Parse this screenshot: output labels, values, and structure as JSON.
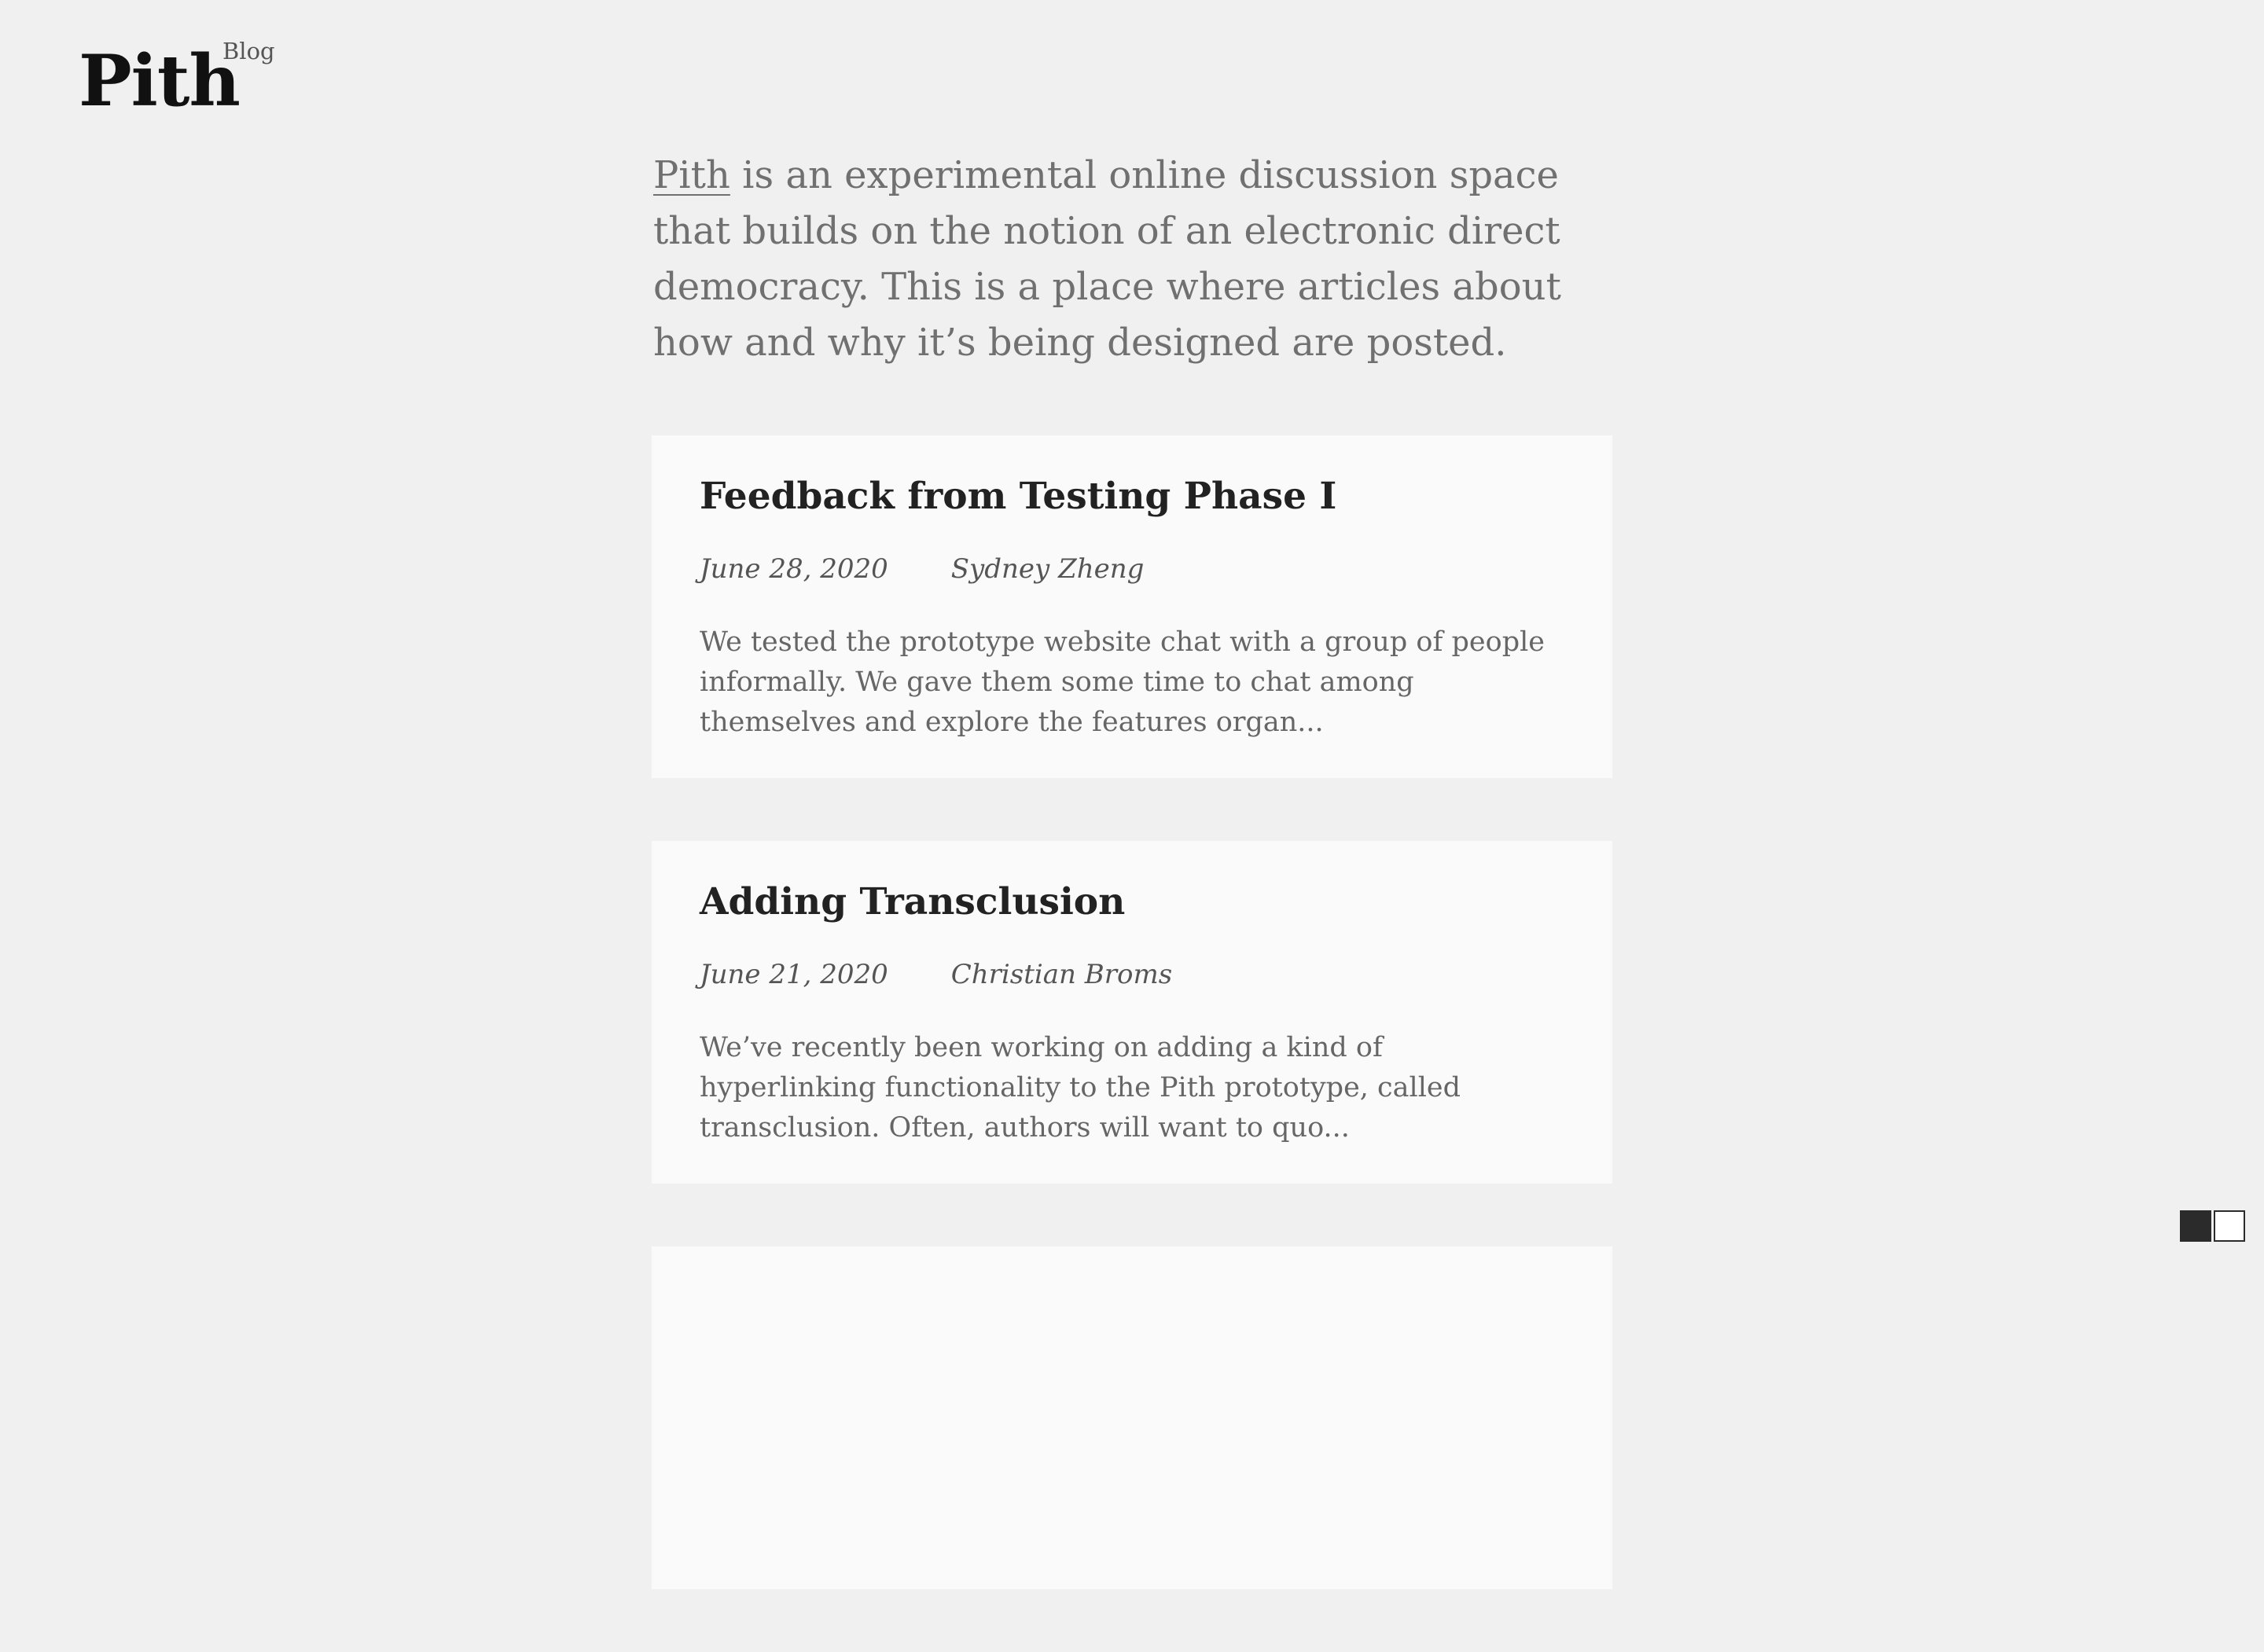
{
  "header": {
    "logo_text": "Pith",
    "logo_subtitle": "Blog"
  },
  "intro": {
    "link_text": "Pith",
    "rest": " is an experimental online discussion space that builds on the notion of an electronic direct democracy. This is a place where articles about how and why it’s being designed are posted."
  },
  "posts": [
    {
      "title": "Feedback from Testing Phase I",
      "date": "June 28, 2020",
      "author": "Sydney Zheng",
      "excerpt": "We tested the prototype website chat with a group of people informally. We gave them some time to chat among themselves and explore the features organ..."
    },
    {
      "title": "Adding Transclusion",
      "date": "June 21, 2020",
      "author": "Christian Broms",
      "excerpt": "We’ve recently been working on adding a kind of hyperlinking functionality to the Pith prototype, called transclusion. Often, authors will want to quo..."
    }
  ],
  "theme_toggle": {
    "dark_color": "#2b2b2b",
    "light_color": "#ffffff"
  },
  "colors": {
    "background": "#f0f0f0",
    "card": "#fafafa",
    "title": "#222222",
    "body_text": "#707070"
  }
}
